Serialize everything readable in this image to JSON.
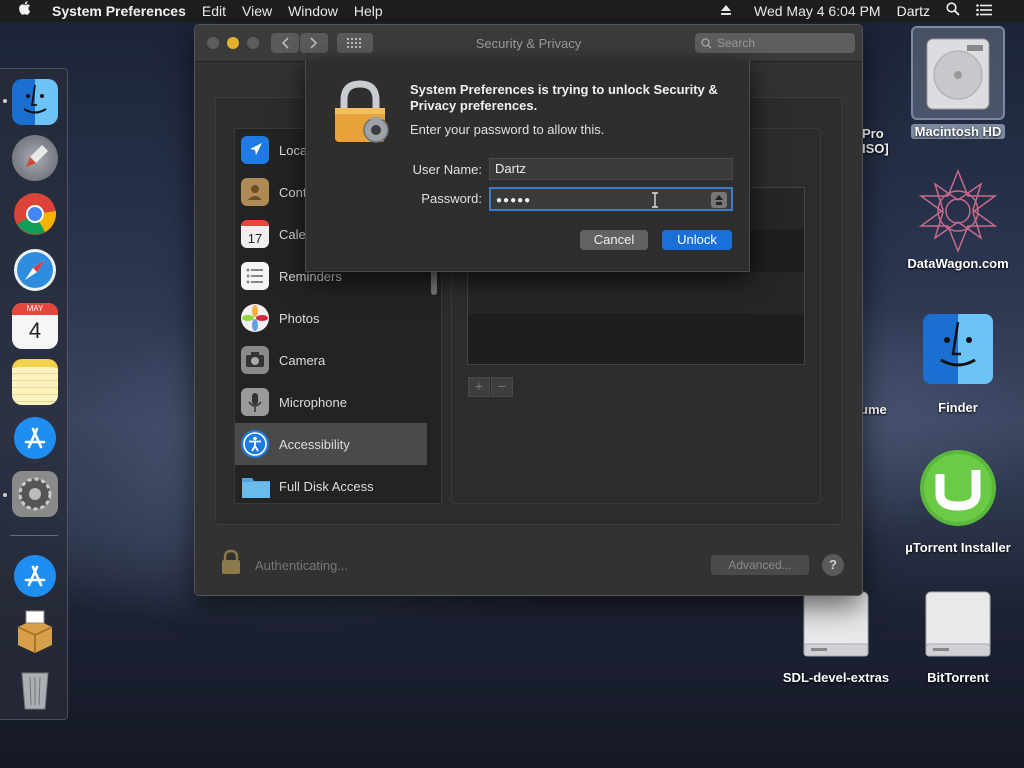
{
  "menubar": {
    "app_name": "System Preferences",
    "menus": [
      "Edit",
      "View",
      "Window",
      "Help"
    ],
    "clock": "Wed May 4  6:04 PM",
    "user": "Dartz"
  },
  "dock": {
    "items": [
      {
        "name": "finder-icon",
        "color": "#3d8fe0"
      },
      {
        "name": "launchpad-icon",
        "color": "#8a8f9a"
      },
      {
        "name": "chrome-icon",
        "color": "#e8e8e8"
      },
      {
        "name": "safari-icon",
        "color": "#2f8de0"
      },
      {
        "name": "calendar-icon",
        "color": "#f4f4f4"
      },
      {
        "name": "notes-icon",
        "color": "#f6e58d"
      },
      {
        "name": "app-store-icon",
        "color": "#1f8ef1"
      },
      {
        "name": "system-preferences-icon",
        "color": "#7d7d7d"
      },
      {
        "name": "app-store-2-icon",
        "color": "#1f8ef1"
      },
      {
        "name": "installer-icon",
        "color": "#d8a04a"
      },
      {
        "name": "trash-icon",
        "color": "#9aa0a6"
      }
    ],
    "calendar_month": "MAY",
    "calendar_day": "4"
  },
  "desktop": {
    "macintosh_hd": "Macintosh HD",
    "pro_label_1": "Pro",
    "pro_label_2": "ISO]",
    "datawagon": "DataWagon.com",
    "finder": "Finder",
    "volume_fragment": "ume",
    "utorrent": "µTorrent Installer",
    "sdl": "SDL-devel-extras",
    "bittorrent": "BitTorrent"
  },
  "window": {
    "title": "Security & Privacy",
    "search_placeholder": "Search",
    "sidebar": [
      {
        "label": "Loca",
        "icon": "location-icon",
        "color": "#1e7be3"
      },
      {
        "label": "Cont",
        "icon": "contacts-icon",
        "color": "#b08a55"
      },
      {
        "label": "Cale",
        "icon": "calendar-icon",
        "color": "#f0f0f0"
      },
      {
        "label": "Reminders",
        "icon": "reminders-icon",
        "color": "#f5f5f5"
      },
      {
        "label": "Photos",
        "icon": "photos-icon",
        "color": "#f0f0f0"
      },
      {
        "label": "Camera",
        "icon": "camera-icon",
        "color": "#8a8a8a"
      },
      {
        "label": "Microphone",
        "icon": "microphone-icon",
        "color": "#9a9a9a"
      },
      {
        "label": "Accessibility",
        "icon": "accessibility-icon",
        "color": "#1e7be3"
      },
      {
        "label": "Full Disk Access",
        "icon": "folder-icon",
        "color": "#4fa3de"
      }
    ],
    "plus": "+",
    "minus": "−",
    "authenticating": "Authenticating...",
    "advanced": "Advanced...",
    "help": "?"
  },
  "dialog": {
    "message_bold": "System Preferences is trying to unlock Security & Privacy preferences.",
    "message": "Enter your password to allow this.",
    "username_label": "User Name:",
    "username_value": "Dartz",
    "password_label": "Password:",
    "password_value": "●●●●●",
    "cancel": "Cancel",
    "unlock": "Unlock"
  }
}
